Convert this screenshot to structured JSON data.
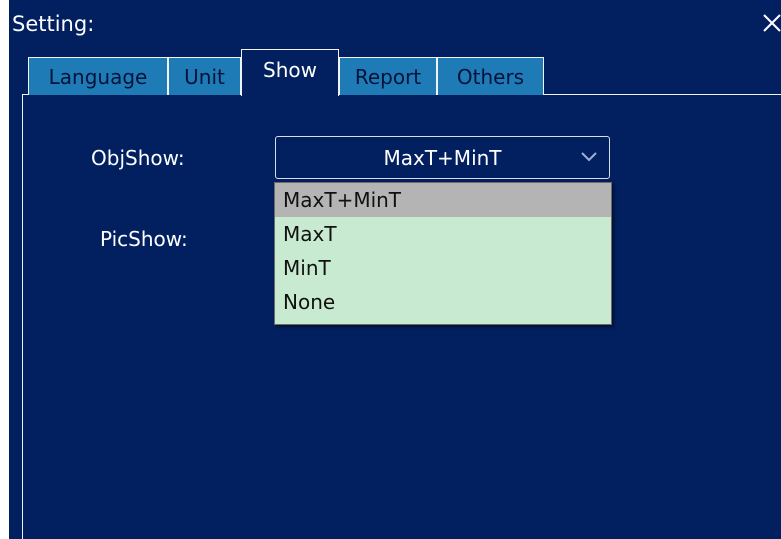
{
  "dialog": {
    "title": "Setting:",
    "close_icon": "close-icon"
  },
  "tabs": [
    {
      "label": "Language",
      "active": false
    },
    {
      "label": "Unit",
      "active": false
    },
    {
      "label": "Show",
      "active": true
    },
    {
      "label": "Report",
      "active": false
    },
    {
      "label": "Others",
      "active": false
    }
  ],
  "show": {
    "objshow_label": "ObjShow:",
    "objshow_value": "MaxT+MinT",
    "picshow_label": "PicShow:",
    "dropdown_icon": "chevron-down-icon",
    "options": [
      "MaxT+MinT",
      "MaxT",
      "MinT",
      "None"
    ],
    "highlighted_option": "MaxT+MinT"
  },
  "colors": {
    "background": "#022060",
    "tab_inactive": "#1f7bb6",
    "dropdown_list": "#c8ead0",
    "dropdown_highlight": "#b4b4b4"
  }
}
